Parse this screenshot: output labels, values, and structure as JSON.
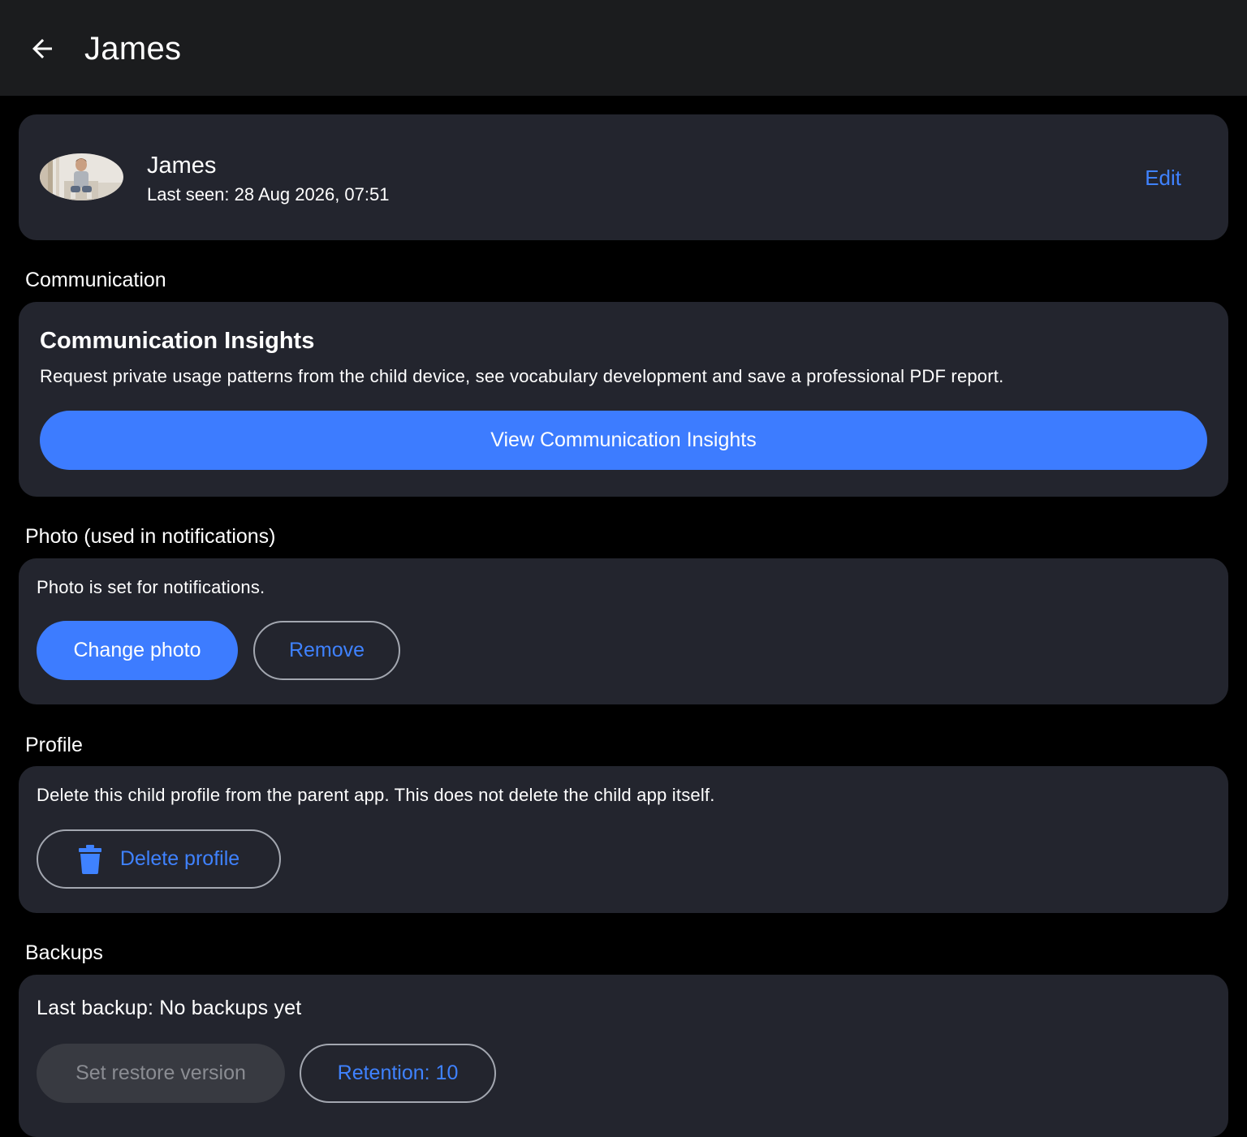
{
  "header": {
    "title": "James",
    "back_icon": "arrow-left-icon"
  },
  "profile_card": {
    "name": "James",
    "last_seen": "Last seen: 28 Aug 2026, 07:51",
    "edit_label": "Edit"
  },
  "communication": {
    "section_label": "Communication",
    "card_title": "Communication Insights",
    "description": "Request private usage patterns from the child device, see vocabulary development and save a professional PDF report.",
    "button_label": "View Communication Insights"
  },
  "photo": {
    "section_label": "Photo (used in notifications)",
    "status_text": "Photo is set for notifications.",
    "change_label": "Change photo",
    "remove_label": "Remove"
  },
  "profile": {
    "section_label": "Profile",
    "description": "Delete this child profile from the parent app. This does not delete the child app itself.",
    "delete_label": "Delete profile",
    "delete_icon": "trash-icon"
  },
  "backups": {
    "section_label": "Backups",
    "last_backup": "Last backup: No backups yet",
    "restore_label": "Set restore version",
    "retention_label": "Retention: 10"
  },
  "colors": {
    "accent": "#3d7cff",
    "link": "#3f82ff",
    "card_bg": "#23252e",
    "topbar_bg": "#1b1c1e",
    "page_bg": "#000000"
  }
}
